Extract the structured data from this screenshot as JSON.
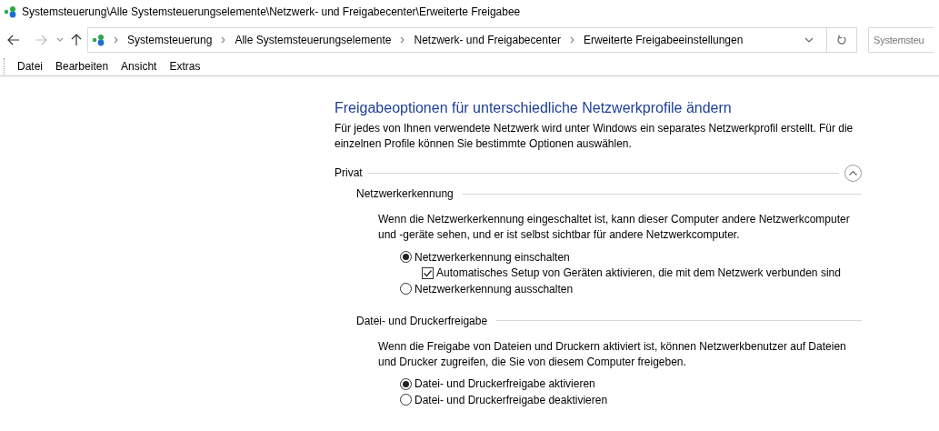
{
  "window": {
    "title": "Systemsteuerung\\Alle Systemsteuerungselemente\\Netzwerk- und Freigabecenter\\Erweiterte Freigabee"
  },
  "address_bar": {
    "breadcrumbs": [
      "Systemsteuerung",
      "Alle Systemsteuerungselemente",
      "Netzwerk- und Freigabecenter",
      "Erweiterte Freigabeeinstellungen"
    ]
  },
  "search": {
    "placeholder": "Systemsteu"
  },
  "menu": [
    "Datei",
    "Bearbeiten",
    "Ansicht",
    "Extras"
  ],
  "heading": "Freigabeoptionen für unterschiedliche Netzwerkprofile ändern",
  "intro": "Für jedes von Ihnen verwendete Netzwerk wird unter Windows ein separates Netzwerkprofil erstellt. Für die einzelnen Profile können Sie bestimmte Optionen auswählen.",
  "profiles": [
    {
      "name": "Privat",
      "expanded": true,
      "sections": [
        {
          "title": "Netzwerkerkennung",
          "description": "Wenn die Netzwerkerkennung eingeschaltet ist, kann dieser Computer andere Netzwerkcomputer und -geräte sehen, und er ist selbst sichtbar für andere Netzwerkcomputer.",
          "options": [
            {
              "kind": "radio",
              "label": "Netzwerkerkennung einschalten",
              "selected": true,
              "children": [
                {
                  "kind": "checkbox",
                  "label": "Automatisches Setup von Geräten aktivieren, die mit dem Netzwerk verbunden sind",
                  "checked": true
                }
              ]
            },
            {
              "kind": "radio",
              "label": "Netzwerkerkennung ausschalten",
              "selected": false
            }
          ]
        },
        {
          "title": "Datei- und Druckerfreigabe",
          "description": "Wenn die Freigabe von Dateien und Druckern aktiviert ist, können Netzwerkbenutzer auf Dateien und Drucker zugreifen, die Sie von diesem Computer freigeben.",
          "options": [
            {
              "kind": "radio",
              "label": "Datei- und Druckerfreigabe aktivieren",
              "selected": true
            },
            {
              "kind": "radio",
              "label": "Datei- und Druckerfreigabe deaktivieren",
              "selected": false
            }
          ]
        }
      ]
    }
  ]
}
